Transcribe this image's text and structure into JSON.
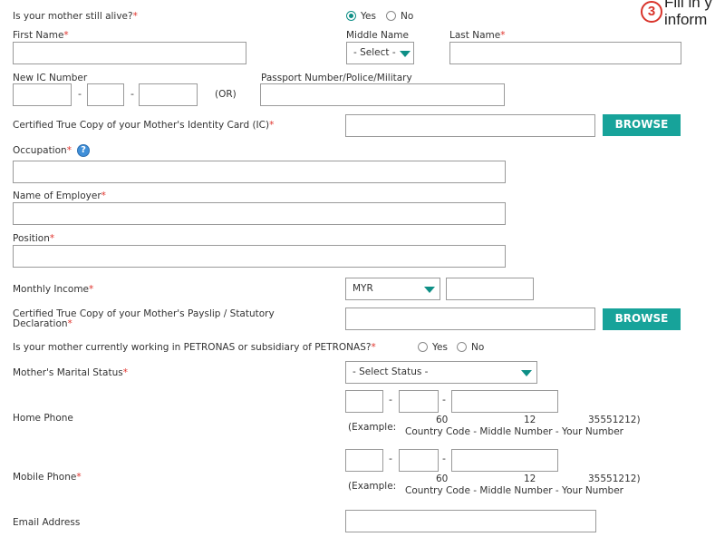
{
  "annotation": {
    "step": "3",
    "line1": "Fill in y",
    "line2": "inform"
  },
  "mother_alive": {
    "label": "Is your mother still alive?",
    "req": "*",
    "yes": "Yes",
    "no": "No",
    "selected": "Yes"
  },
  "name": {
    "first_label": "First Name",
    "first_req": "*",
    "middle_label": "Middle Name",
    "middle_value": "- Select -",
    "last_label": "Last Name",
    "last_req": "*"
  },
  "ic": {
    "label": "New IC Number",
    "dash": "-",
    "or": "(OR)",
    "passport_label": "Passport Number/Police/Military"
  },
  "ic_copy": {
    "label": "Certified True Copy of your Mother's Identity Card (IC)",
    "req": "*",
    "button": "BROWSE"
  },
  "occupation": {
    "label": "Occupation",
    "req": "*",
    "help": "?"
  },
  "employer": {
    "label": "Name of Employer",
    "req": "*"
  },
  "position": {
    "label": "Position",
    "req": "*"
  },
  "income": {
    "label": "Monthly Income",
    "req": "*",
    "currency": "MYR"
  },
  "payslip": {
    "label1": "Certified True Copy of your Mother's Payslip / Statutory",
    "label2": "Declaration",
    "req": "*",
    "button": "BROWSE"
  },
  "petronas": {
    "label": "Is your mother currently working in PETRONAS or subsidiary of PETRONAS?",
    "req": "*",
    "yes": "Yes",
    "no": "No"
  },
  "marital": {
    "label": "Mother's Marital Status",
    "req": "*",
    "value": "- Select Status -"
  },
  "home_phone": {
    "label": "Home Phone",
    "example_prefix": "(Example:",
    "ex_cc": "60",
    "ex_mid": "12",
    "ex_num": "35551212)",
    "legend": "Country Code - Middle Number - Your Number"
  },
  "mobile_phone": {
    "label": "Mobile Phone",
    "req": "*",
    "example_prefix": "(Example:",
    "ex_cc": "60",
    "ex_mid": "12",
    "ex_num": "35551212)",
    "legend": "Country Code - Middle Number - Your Number"
  },
  "email": {
    "label": "Email Address"
  },
  "colors": {
    "accent": "#17a39a",
    "required": "#e0342d",
    "annotation": "#d9342b"
  }
}
